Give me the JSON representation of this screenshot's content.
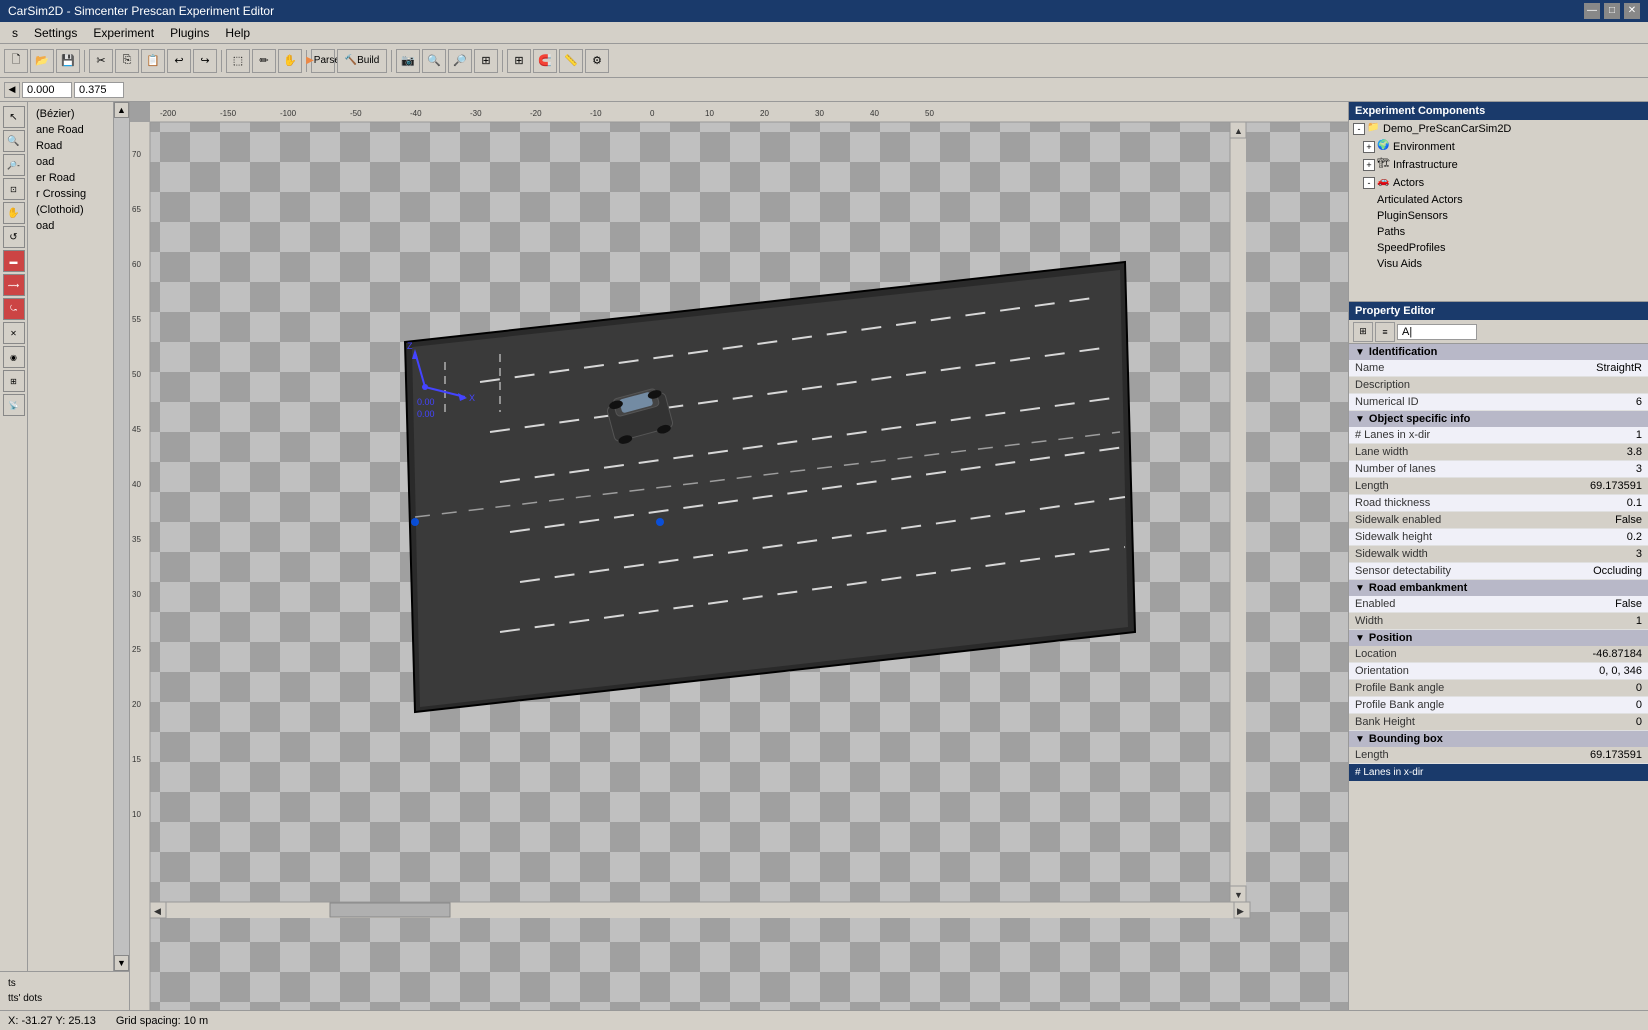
{
  "titlebar": {
    "title": "CarSim2D - Simcenter Prescan Experiment Editor",
    "controls": [
      "—",
      "□",
      "✕"
    ]
  },
  "menubar": {
    "items": [
      "s",
      "Settings",
      "Experiment",
      "Plugins",
      "Help"
    ]
  },
  "toolbar": {
    "parse_label": "Parse",
    "build_label": "Build",
    "coords": {
      "x": "0.000",
      "y": "0.375"
    }
  },
  "left_panel": {
    "road_items": [
      "(Bézier)",
      "ane Road",
      "Road",
      "oad",
      "er Road",
      "r Crossing",
      "(Clothoid)",
      "oad"
    ],
    "bottom_items": [
      "ts",
      "tts' dots"
    ]
  },
  "rulers": {
    "h_ticks": [
      "-200",
      "-150",
      "-100",
      "-50",
      "-40",
      "-30",
      "-20",
      "-10",
      "0",
      "10",
      "20",
      "30",
      "40",
      "50"
    ],
    "v_ticks": [
      "70",
      "65",
      "60",
      "55",
      "50",
      "45",
      "40",
      "35",
      "30",
      "25",
      "20",
      "15",
      "10"
    ]
  },
  "experiment_components": {
    "title": "Experiment Components",
    "tree": [
      {
        "label": "Demo_PreScanCarSim2D",
        "indent": 0,
        "expand": "-",
        "icon": "📁"
      },
      {
        "label": "Environment",
        "indent": 1,
        "expand": "+",
        "icon": "🌍"
      },
      {
        "label": "Infrastructure",
        "indent": 1,
        "expand": "+",
        "icon": "🏗"
      },
      {
        "label": "Actors",
        "indent": 1,
        "expand": "-",
        "icon": "🚗"
      },
      {
        "label": "Articulated Actors",
        "indent": 2,
        "expand": null,
        "icon": ""
      },
      {
        "label": "PluginSensors",
        "indent": 2,
        "expand": null,
        "icon": ""
      },
      {
        "label": "Paths",
        "indent": 2,
        "expand": null,
        "icon": ""
      },
      {
        "label": "SpeedProfiles",
        "indent": 2,
        "expand": null,
        "icon": ""
      },
      {
        "label": "Visu Aids",
        "indent": 2,
        "expand": null,
        "icon": ""
      }
    ]
  },
  "property_editor": {
    "title": "Property Editor",
    "search_placeholder": "A|",
    "sections": [
      {
        "name": "Identification",
        "expanded": true,
        "properties": [
          {
            "name": "Name",
            "value": "StraightR"
          },
          {
            "name": "Description",
            "value": ""
          },
          {
            "name": "Numerical ID",
            "value": "6"
          }
        ]
      },
      {
        "name": "Object specific info",
        "expanded": true,
        "properties": [
          {
            "name": "# Lanes in x-dir",
            "value": "1"
          },
          {
            "name": "Lane width",
            "value": "3.8"
          },
          {
            "name": "Number of lanes",
            "value": "3"
          },
          {
            "name": "Length",
            "value": "69.173591"
          },
          {
            "name": "Road thickness",
            "value": "0.1"
          },
          {
            "name": "Sidewalk enabled",
            "value": "False"
          },
          {
            "name": "Sidewalk height",
            "value": "0.2"
          },
          {
            "name": "Sidewalk width",
            "value": "3"
          },
          {
            "name": "Sensor detectability",
            "value": "Occluding"
          }
        ]
      },
      {
        "name": "Road embankment",
        "expanded": true,
        "properties": [
          {
            "name": "Enabled",
            "value": "False"
          },
          {
            "name": "Width",
            "value": "1"
          }
        ]
      },
      {
        "name": "Position",
        "expanded": true,
        "properties": [
          {
            "name": "Location",
            "value": "-46.87184"
          },
          {
            "name": "Orientation",
            "value": "0, 0, 346"
          },
          {
            "name": "Profile Bank angle",
            "value": "0"
          },
          {
            "name": "Profile Bank angle",
            "value": "0"
          },
          {
            "name": "Bank Height",
            "value": "0"
          }
        ]
      },
      {
        "name": "Bounding box",
        "expanded": true,
        "properties": [
          {
            "name": "Length",
            "value": "69.173591"
          }
        ]
      }
    ],
    "bottom_label": "# Lanes in x-dir"
  },
  "statusbar": {
    "coords": "X: -31.27  Y: 25.13",
    "grid": "Grid spacing: 10 m"
  }
}
